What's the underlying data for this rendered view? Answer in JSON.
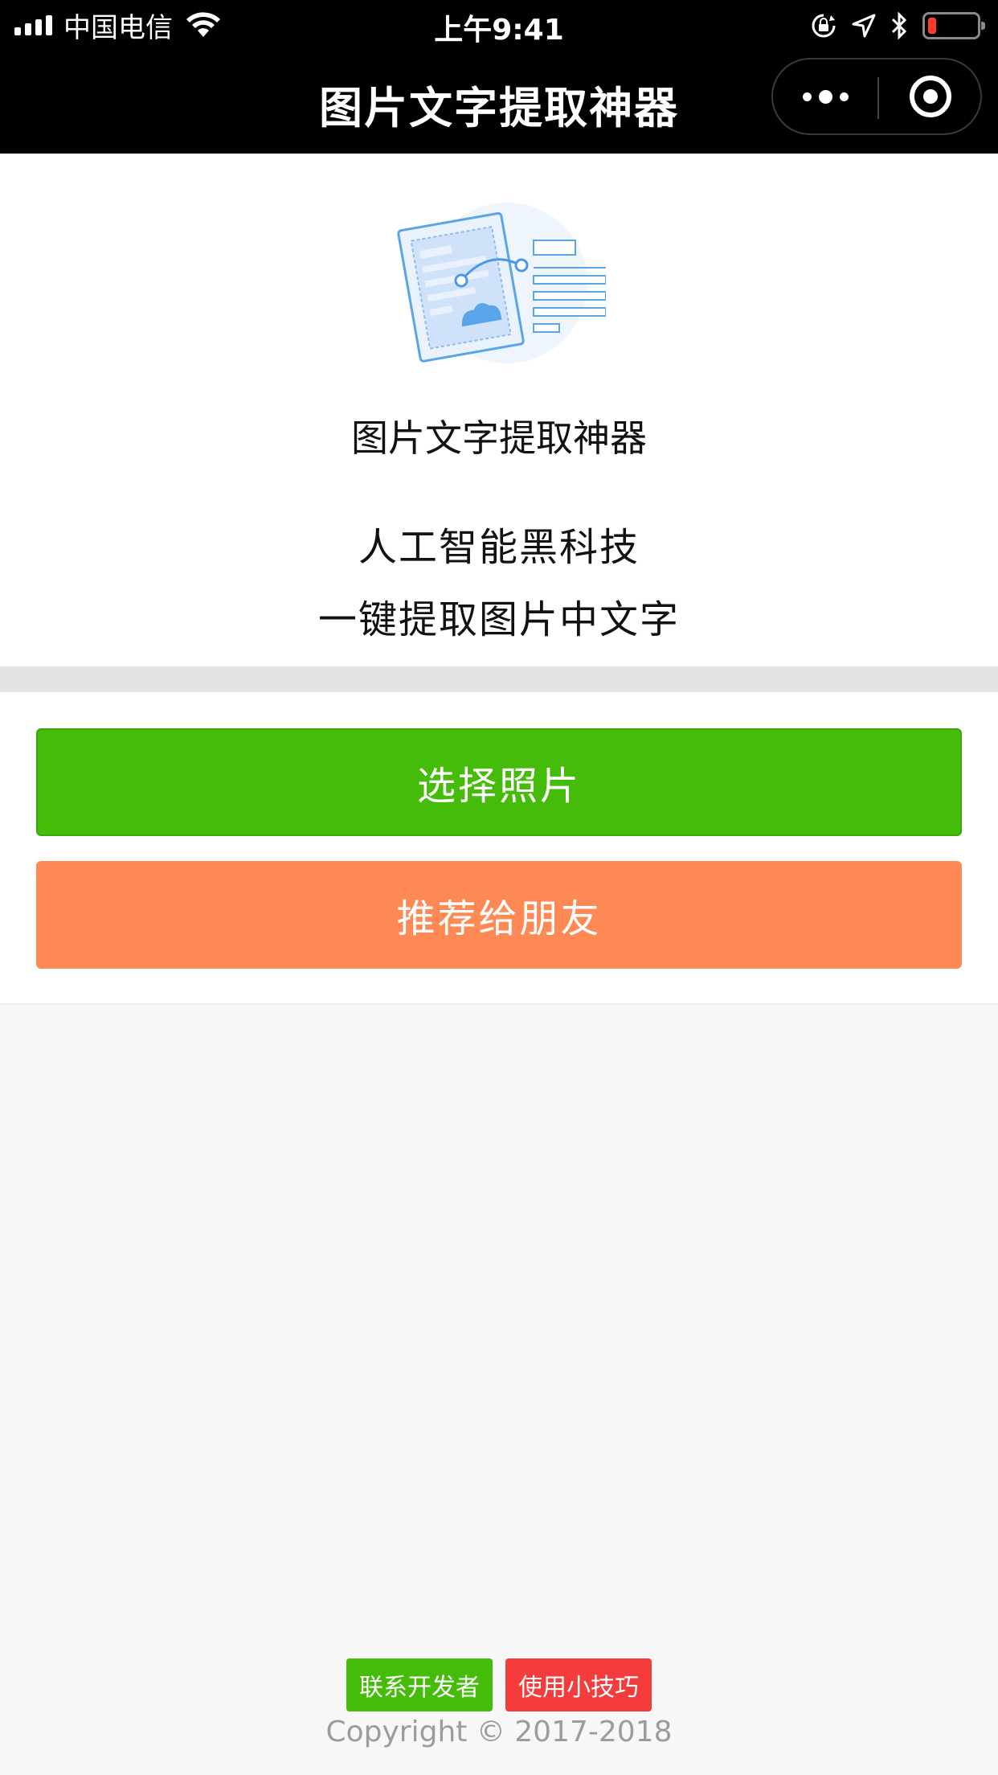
{
  "status_bar": {
    "carrier": "中国电信",
    "time": "上午9:41",
    "icons": [
      "signal-icon",
      "wifi-icon",
      "rotation-lock-icon",
      "location-icon",
      "bluetooth-icon",
      "battery-icon"
    ],
    "battery_color": "#ff3b30"
  },
  "nav": {
    "title": "图片文字提取神器",
    "more_icon": "more-dots-icon",
    "close_icon": "target-close-icon"
  },
  "hero": {
    "illustration_icon": "document-scan-illustration-icon",
    "title": "图片文字提取神器",
    "line1": "人工智能黑科技",
    "line2": "一键提取图片中文字"
  },
  "actions": {
    "select_photo": "选择照片",
    "recommend": "推荐给朋友",
    "primary_color": "#44bc09",
    "share_color": "#ff8955"
  },
  "footer": {
    "contact": "联系开发者",
    "tips": "使用小技巧",
    "copyright": "Copyright © 2017-2018"
  }
}
